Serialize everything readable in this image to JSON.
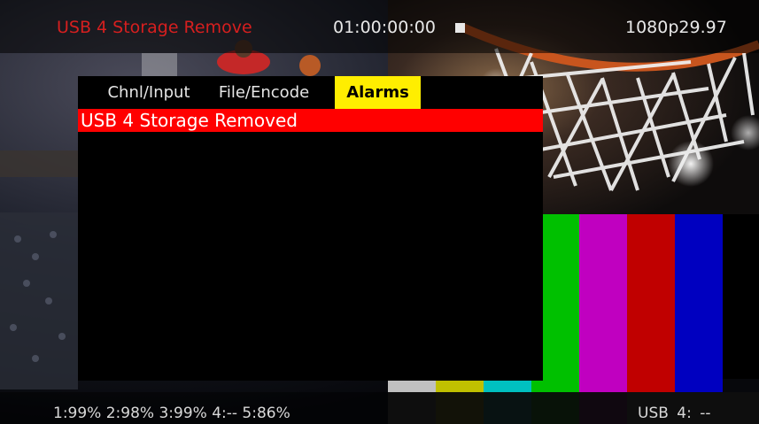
{
  "status_bar": {
    "alarm_message": "USB 4 Storage Remove",
    "timecode": "01:00:00:00",
    "transport_icon": "stop-icon",
    "video_format": "1080p29.97"
  },
  "menu": {
    "tabs": [
      {
        "label": "Chnl/Input",
        "active": false
      },
      {
        "label": "File/Encode",
        "active": false
      },
      {
        "label": "Alarms",
        "active": true
      }
    ],
    "alarms": [
      {
        "text": "USB 4 Storage Removed"
      }
    ]
  },
  "bottom_bar": {
    "storage_levels": "1:99% 2:98% 3:99% 4:-- 5:86%",
    "usb_status": "USB 4: --"
  },
  "colors": {
    "alarm_text": "#d61f1f",
    "active_tab": "#ffee00",
    "alarm_highlight": "#ff0000",
    "color_bars": [
      "#c0c0c0",
      "#c0c000",
      "#00c0c0",
      "#00c000",
      "#c000c0",
      "#c00000",
      "#0000c0",
      "#000000"
    ]
  }
}
